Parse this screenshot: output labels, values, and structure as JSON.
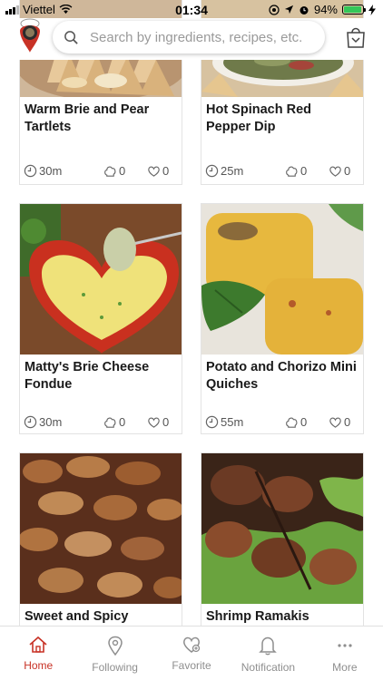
{
  "status_bar": {
    "carrier": "Viettel",
    "time": "01:34",
    "battery": "94%",
    "battery_level": 0.94
  },
  "search": {
    "placeholder": "Search by ingredients, recipes, etc."
  },
  "recipes": [
    {
      "title": "Warm Brie and Pear Tartlets",
      "time": "30m",
      "cooked": "0",
      "favorites": "0"
    },
    {
      "title": "Hot Spinach Red Pepper Dip",
      "time": "25m",
      "cooked": "0",
      "favorites": "0"
    },
    {
      "title": "Matty's Brie Cheese Fondue",
      "time": "30m",
      "cooked": "0",
      "favorites": "0"
    },
    {
      "title": "Potato and Chorizo Mini Quiches",
      "time": "55m",
      "cooked": "0",
      "favorites": "0"
    },
    {
      "title": "Sweet and Spicy Almonds",
      "time": "",
      "cooked": "",
      "favorites": ""
    },
    {
      "title": "Shrimp Ramakis",
      "time": "",
      "cooked": "",
      "favorites": ""
    }
  ],
  "tabs": [
    {
      "label": "Home",
      "icon": "home-icon",
      "active": true
    },
    {
      "label": "Following",
      "icon": "location-pin-icon",
      "active": false
    },
    {
      "label": "Favorite",
      "icon": "heart-icon",
      "active": false
    },
    {
      "label": "Notification",
      "icon": "bell-icon",
      "active": false
    },
    {
      "label": "More",
      "icon": "more-dots-icon",
      "active": false
    }
  ],
  "colors": {
    "accent": "#c83226",
    "inactive": "#8e8e8e",
    "battery": "#34c759"
  }
}
